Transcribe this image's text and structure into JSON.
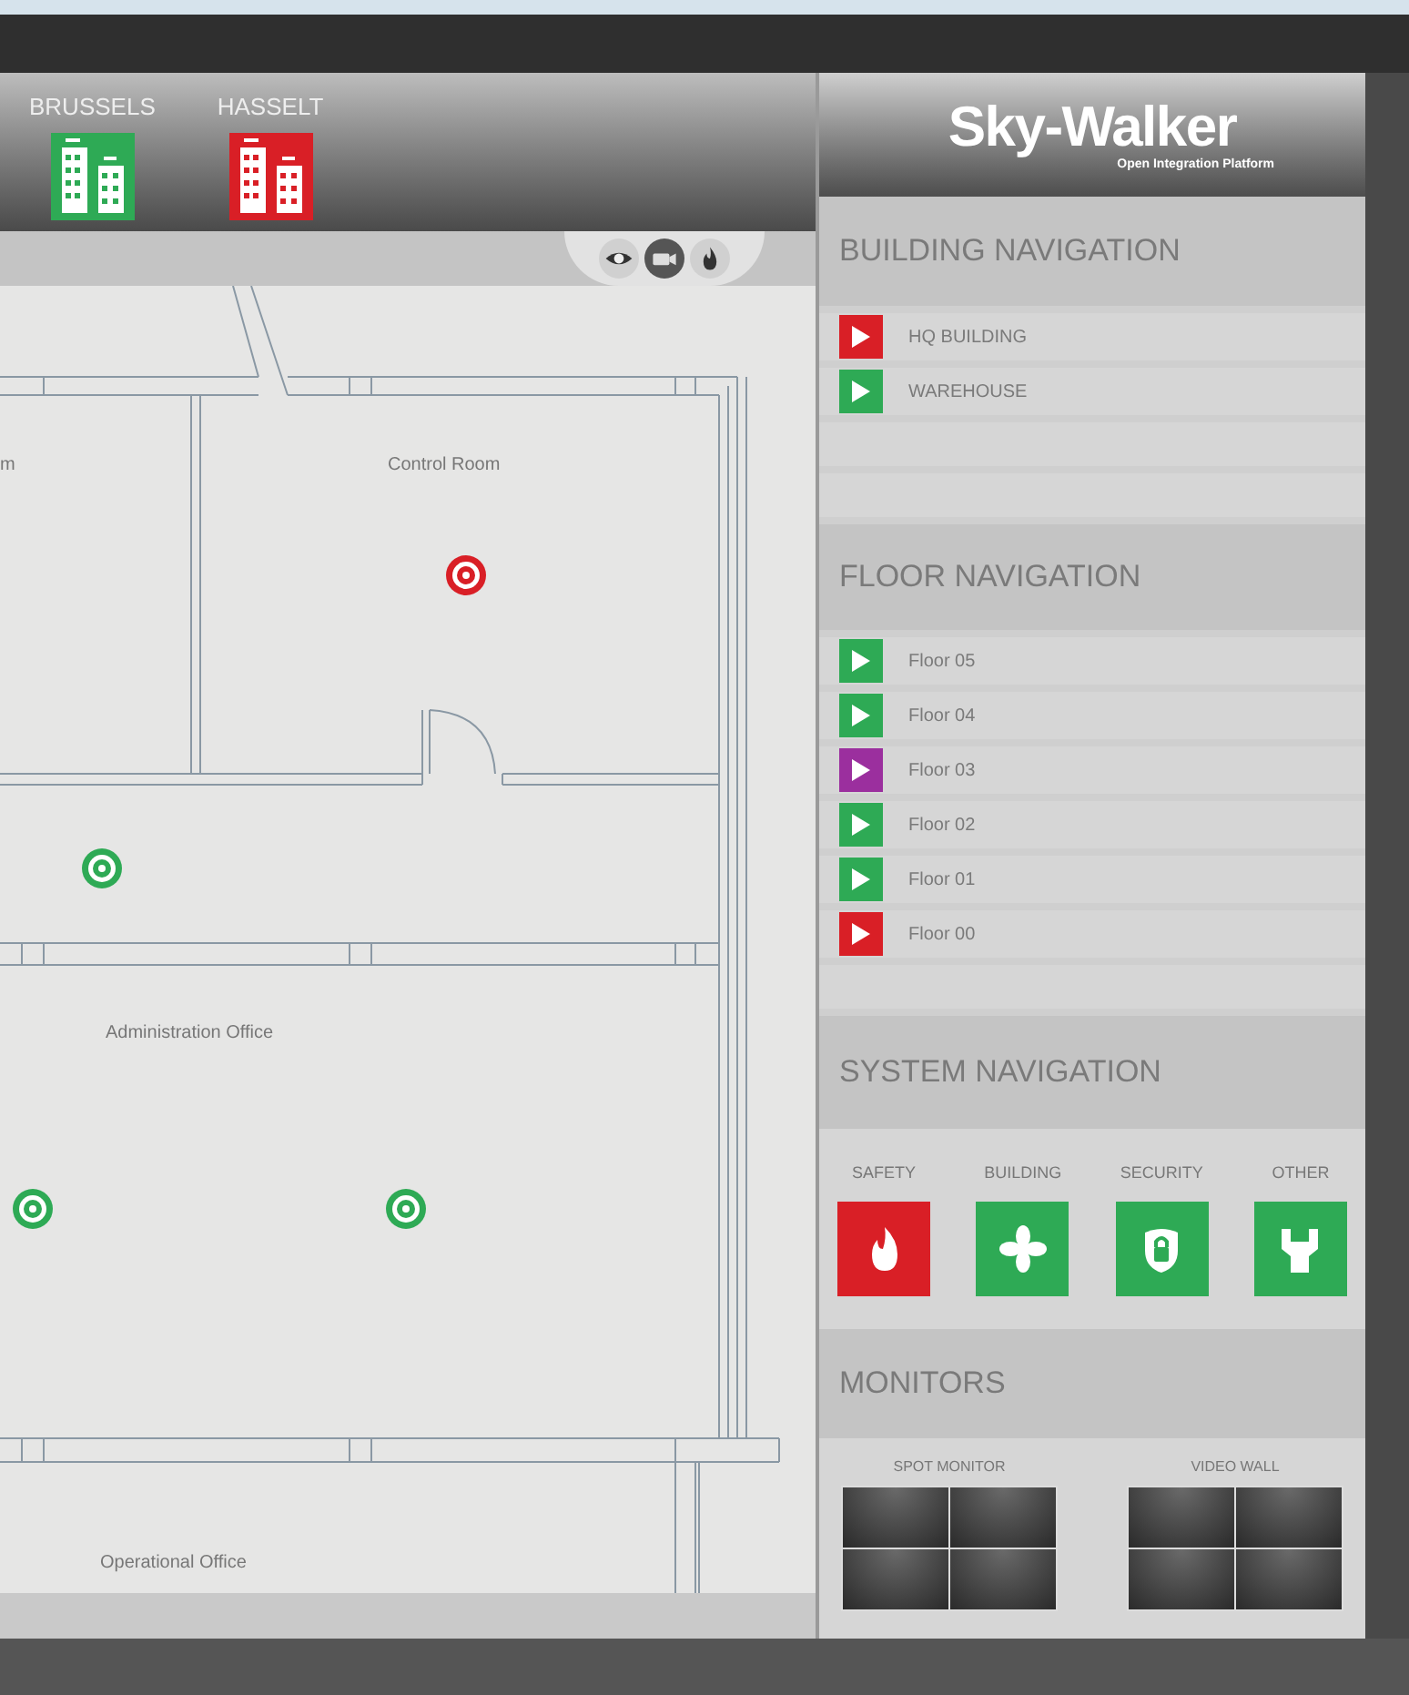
{
  "cities": [
    {
      "name": "BRUSSELS",
      "color": "#2eaa55"
    },
    {
      "name": "HASSELT",
      "color": "#d91f26"
    }
  ],
  "view_toggles": [
    {
      "kind": "eye",
      "selected": false
    },
    {
      "kind": "camera",
      "selected": true
    },
    {
      "kind": "fire",
      "selected": false
    }
  ],
  "floor_plan": {
    "rooms": [
      "m",
      "Control Room",
      "Administration Office",
      "Operational Office"
    ],
    "markers": [
      {
        "color": "#d91f26"
      },
      {
        "color": "#2eaa55"
      },
      {
        "color": "#2eaa55"
      },
      {
        "color": "#2eaa55"
      }
    ]
  },
  "logo": {
    "title": "Sky-Walker",
    "subtitle": "Open Integration Platform"
  },
  "building_navigation": {
    "title": "BUILDING NAVIGATION",
    "items": [
      {
        "label": "HQ BUILDING",
        "color": "#d91f26"
      },
      {
        "label": "WAREHOUSE",
        "color": "#2eaa55"
      }
    ]
  },
  "floor_navigation": {
    "title": "FLOOR NAVIGATION",
    "items": [
      {
        "label": "Floor 05",
        "color": "#2eaa55"
      },
      {
        "label": "Floor 04",
        "color": "#2eaa55"
      },
      {
        "label": "Floor 03",
        "color": "#9b2f9e"
      },
      {
        "label": "Floor 02",
        "color": "#2eaa55"
      },
      {
        "label": "Floor 01",
        "color": "#2eaa55"
      },
      {
        "label": "Floor 00",
        "color": "#d91f26"
      }
    ]
  },
  "system_navigation": {
    "title": "SYSTEM NAVIGATION",
    "items": [
      {
        "label": "SAFETY",
        "kind": "fire",
        "color": "#d91f26"
      },
      {
        "label": "BUILDING",
        "kind": "fan",
        "color": "#2eaa55"
      },
      {
        "label": "SECURITY",
        "kind": "lock",
        "color": "#2eaa55"
      },
      {
        "label": "OTHER",
        "kind": "wrench",
        "color": "#2eaa55"
      }
    ]
  },
  "monitors": {
    "title": "MONITORS",
    "groups": [
      {
        "label": "SPOT MONITOR"
      },
      {
        "label": "VIDEO WALL"
      }
    ]
  }
}
